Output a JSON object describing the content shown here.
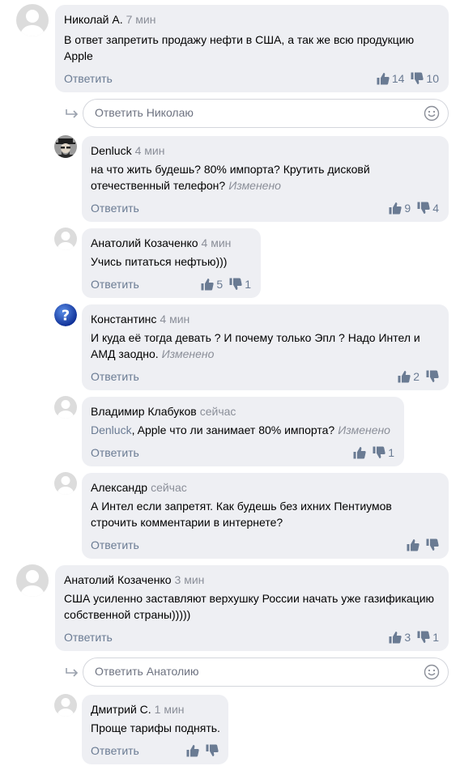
{
  "comments": [
    {
      "author": "Николай А.",
      "time": "7 мин",
      "lines": [
        "В ответ запретить продажу нефти в США, а так же всю продукцию",
        "Apple"
      ],
      "edited": "",
      "reply": "Ответить",
      "likes": "14",
      "dislikes": "10"
    },
    {
      "author": "Denluck",
      "time": "4 мин",
      "lines": [
        "на что жить будешь? 80% импорта? Крутить дисковй",
        "отечественный телефон?"
      ],
      "edited": "Изменено",
      "reply": "Ответить",
      "likes": "9",
      "dislikes": "4"
    },
    {
      "author": "Анатолий Козаченко",
      "time": "4 мин",
      "lines": [
        "Учись питаться нефтью)))"
      ],
      "edited": "",
      "reply": "Ответить",
      "likes": "5",
      "dislikes": "1"
    },
    {
      "author": "Константинс",
      "time": "4 мин",
      "lines": [
        "И куда её тогда девать ? И почему только Эпл ?  Надо Интел и",
        "АМД заодно."
      ],
      "edited": "Изменено",
      "reply": "Ответить",
      "likes": "2",
      "dislikes": ""
    },
    {
      "author": "Владимир Клабуков",
      "time": "сейчас",
      "mention": "Denluck",
      "lines": [
        ", Apple что ли занимает 80% импорта?"
      ],
      "edited": "Изменено",
      "reply": "Ответить",
      "likes": "",
      "dislikes": "1"
    },
    {
      "author": "Александр",
      "time": "сейчас",
      "lines": [
        "А Интел если запретят. Как будешь без ихних Пентиумов",
        "строчить комментарии в интернете?"
      ],
      "edited": "",
      "reply": "Ответить",
      "likes": "",
      "dislikes": ""
    },
    {
      "author": "Анатолий Козаченко",
      "time": "3 мин",
      "lines": [
        "США усиленно заставляют верхушку России начать уже газификацию",
        "собственной страны)))))"
      ],
      "edited": "",
      "reply": "Ответить",
      "likes": "3",
      "dislikes": "1"
    },
    {
      "author": "Дмитрий С.",
      "time": "1 мин",
      "lines": [
        "Проще тарифы поднять."
      ],
      "edited": "",
      "reply": "Ответить",
      "likes": "",
      "dislikes": ""
    }
  ],
  "reply_boxes": [
    {
      "placeholder": "Ответить Николаю"
    },
    {
      "placeholder": "Ответить Анатолию"
    }
  ],
  "colors": {
    "bubble": "#eeeff3",
    "muted": "#8a8e98",
    "link": "#6a7b93",
    "border": "#d4d6dc"
  },
  "icons": {
    "like": "thumbs-up-icon",
    "dislike": "thumbs-down-icon",
    "reply_arrow": "reply-arrow-icon",
    "emoji": "smiley-icon"
  }
}
